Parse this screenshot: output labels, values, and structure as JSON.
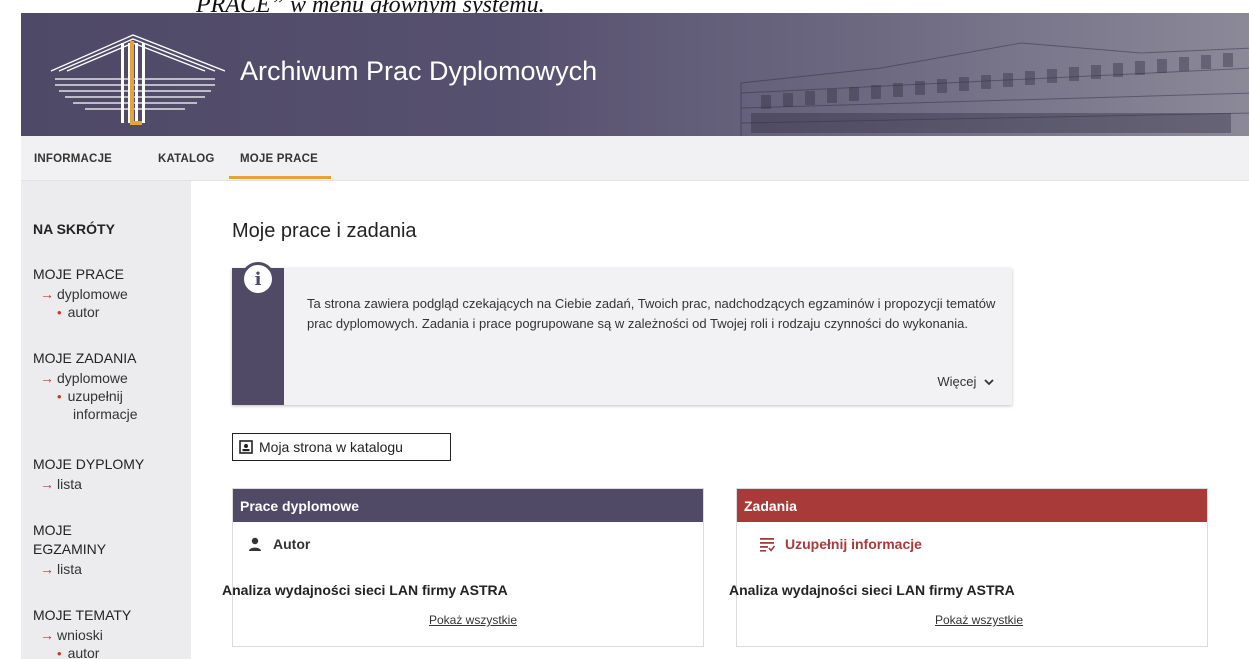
{
  "doc": {
    "caption": "PRACE” w menu głównym systemu."
  },
  "header": {
    "app_title": "Archiwum Prac Dyplomowych"
  },
  "nav": {
    "items": [
      {
        "label": "INFORMACJE"
      },
      {
        "label": "KATALOG"
      },
      {
        "label": "MOJE PRACE",
        "active": true
      }
    ]
  },
  "sidebar": {
    "heading": "NA SKRÓTY",
    "sections": [
      {
        "title": "MOJE PRACE",
        "link": "dyplomowe",
        "sub": "autor"
      },
      {
        "title": "MOJE ZADANIA",
        "link": "dyplomowe",
        "sub_line1": "uzupełnij",
        "sub_line2": "informacje"
      },
      {
        "title": "MOJE DYPLOMY",
        "link": "lista"
      },
      {
        "title_line1": "MOJE",
        "title_line2": "EGZAMINY",
        "link": "lista"
      },
      {
        "title": "MOJE TEMATY",
        "link": "wnioski",
        "sub": "autor"
      }
    ]
  },
  "main": {
    "title": "Moje prace i zadania",
    "info": {
      "text": "Ta strona zawiera podgląd czekających na Ciebie zadań, Twoich prac, nadchodzących egzaminów i propozycji tematów prac dyplomowych. Zadania i prace pogrupowane są w zależności od Twojej roli i rodzaju czynności do wykonania.",
      "more": "Więcej"
    },
    "catalog_button": "Moja strona w katalogu",
    "panels": [
      {
        "title": "Prace dyplomowe",
        "subtitle": "Autor",
        "item": "Analiza wydajności sieci LAN firmy ASTRA",
        "show_all": "Pokaż wszystkie"
      },
      {
        "title": "Zadania",
        "subtitle": "Uzupełnij informacje",
        "item": "Analiza wydajności sieci LAN firmy ASTRA",
        "show_all": "Pokaż wszystkie"
      }
    ]
  },
  "colors": {
    "header_purple": "#504a67",
    "accent_orange": "#e8a23c",
    "panel_red": "#a83a3a",
    "link_red": "#c0392b"
  },
  "icons": {
    "logo": "library-pillars-logo",
    "info": "info-icon",
    "catalog": "id-card-icon",
    "author": "person-icon",
    "task": "checklist-icon",
    "more": "chevron-down-icon"
  }
}
